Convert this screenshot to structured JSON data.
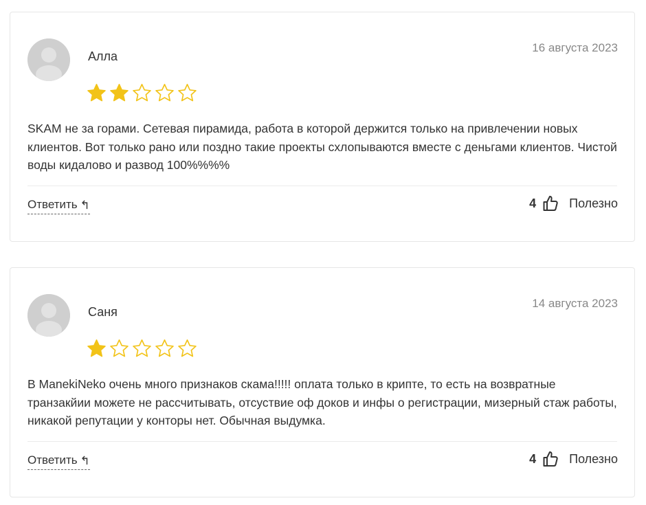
{
  "colors": {
    "star_filled": "#F2C318",
    "star_empty_outline": "#F2C318",
    "avatar_bg": "#d0d0d0"
  },
  "reviews": [
    {
      "author": "Алла",
      "date": "16 августа 2023",
      "rating": 2,
      "max_rating": 5,
      "text": "SKAM не за горами. Сетевая пирамида, работа в которой держится только на привлечении новых клиентов. Вот только рано или поздно такие проекты схлопываются вместе с деньгами клиентов. Чистой воды кидалово и развод 100%%%%",
      "reply_label": "Ответить",
      "reply_icon": "↰",
      "helpful_count": "4",
      "helpful_label": "Полезно"
    },
    {
      "author": "Саня",
      "date": "14 августа 2023",
      "rating": 1,
      "max_rating": 5,
      "text": "В ManekiNeko очень много признаков скама!!!!! оплата только в крипте, то есть на возвратные транзакйии можете не рассчитывать, отсуствие оф доков и инфы о регистрации, мизерный стаж работы, никакой репутации у конторы нет. Обычная выдумка.",
      "reply_label": "Ответить",
      "reply_icon": "↰",
      "helpful_count": "4",
      "helpful_label": "Полезно"
    }
  ]
}
